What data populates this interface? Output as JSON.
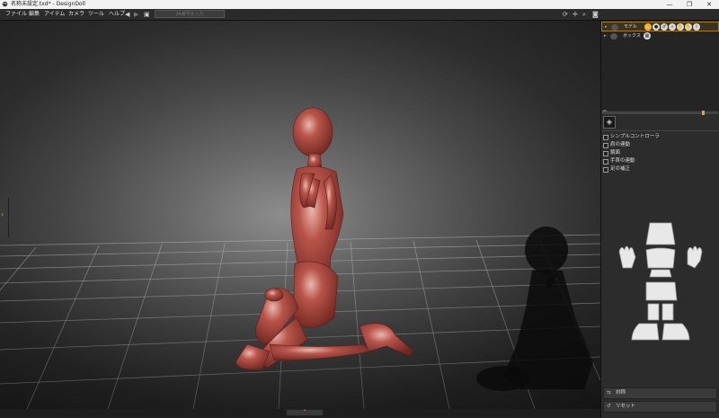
{
  "window": {
    "title": "名称未設定.txd* - DesignDoll",
    "minimize_glyph": "—",
    "restore_glyph": "❐",
    "close_glyph": "✕"
  },
  "menu": [
    "ファイル",
    "編集",
    "アイテム",
    "カメラ",
    "ツール",
    "ヘルプ"
  ],
  "toolbar": {
    "search_placeholder": "3A番号を入力",
    "icons": [
      "back-arrow-icon",
      "forward-arrow-icon",
      "camera-icon",
      "refresh-icon",
      "move-icon",
      "zoom-icon",
      "screenshot-icon"
    ]
  },
  "scene_tree": {
    "items": [
      {
        "label": "モデル",
        "selected": true
      },
      {
        "label": "ボックス",
        "selected": false
      }
    ]
  },
  "options": [
    {
      "label": "シンプルコントローラ"
    },
    {
      "label": "肩の連動"
    },
    {
      "label": "鏡面"
    },
    {
      "label": "手首の連動"
    },
    {
      "label": "足の補正"
    }
  ],
  "footer": {
    "symmetry_label": "対称",
    "reset_label": "リセット"
  },
  "colors": {
    "accent": "#e3a531",
    "doll": "#a4443a",
    "panel": "#2c2c2c"
  }
}
